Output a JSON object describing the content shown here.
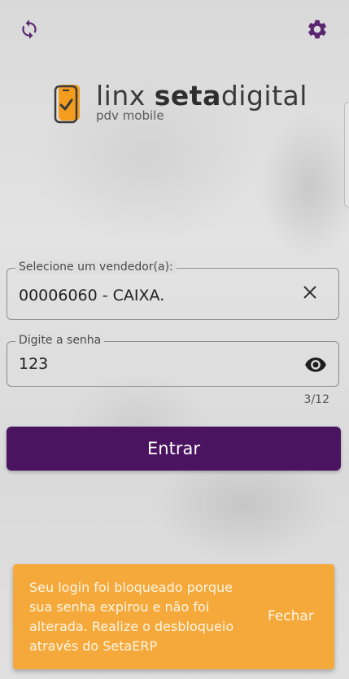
{
  "app": {
    "logo_brand_light": "linx ",
    "logo_brand_bold": "seta",
    "logo_brand_tail": "digital",
    "logo_subtitle": "pdv mobile"
  },
  "toolbar": {
    "refresh_icon": "refresh-icon",
    "settings_icon": "gear-icon",
    "accent": "#5b2670"
  },
  "vendor_field": {
    "label": "Selecione um vendedor(a):",
    "value": "00006060 - CAIXA."
  },
  "password_field": {
    "label": "Digite a senha",
    "value": "123",
    "counter": "3/12"
  },
  "enter_button": {
    "label": "Entrar",
    "color": "#4b1460"
  },
  "snackbar": {
    "message": "Seu login foi bloqueado porque sua senha expirou e não foi alterada. Realize o desbloqueio através do SetaERP",
    "action": "Fechar",
    "color": "#f6a93b"
  }
}
